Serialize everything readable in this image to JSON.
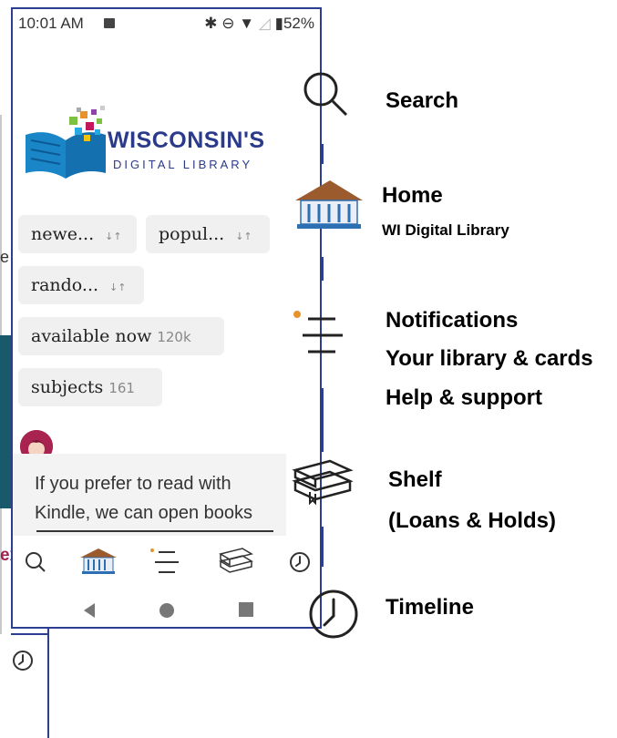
{
  "status_bar": {
    "time": "10:01 AM",
    "battery": "52%"
  },
  "logo": {
    "title": "WISCONSIN'S",
    "subtitle": "DIGITAL LIBRARY"
  },
  "chips": [
    {
      "label": "newe...",
      "count": ""
    },
    {
      "label": "popul...",
      "count": ""
    },
    {
      "label": "rando...",
      "count": ""
    },
    {
      "label": "available now",
      "count": "120k"
    },
    {
      "label": "subjects",
      "count": "161"
    }
  ],
  "message": {
    "text": "If you prefer to read with Kindle, we can open books"
  },
  "tabbar_icons": [
    "search-icon",
    "library-building-icon",
    "menu-icon",
    "shelf-books-icon",
    "timeline-clock-icon"
  ],
  "legend": {
    "search": "Search",
    "home_title": "Home",
    "home_sub": "WI Digital Library",
    "notifications": "Notifications",
    "library_cards": "Your library & cards",
    "help": "Help & support",
    "shelf": "Shelf",
    "shelf_sub": "(Loans & Holds)",
    "timeline": "Timeline"
  },
  "background_fragments": {
    "red_word": "ex",
    "letter": "e i"
  },
  "colors": {
    "frame_blue": "#2c3e8f",
    "logo_blue": "#2b3a8a",
    "accent_orange": "#e8922b",
    "avatar_red": "#a8234f"
  }
}
